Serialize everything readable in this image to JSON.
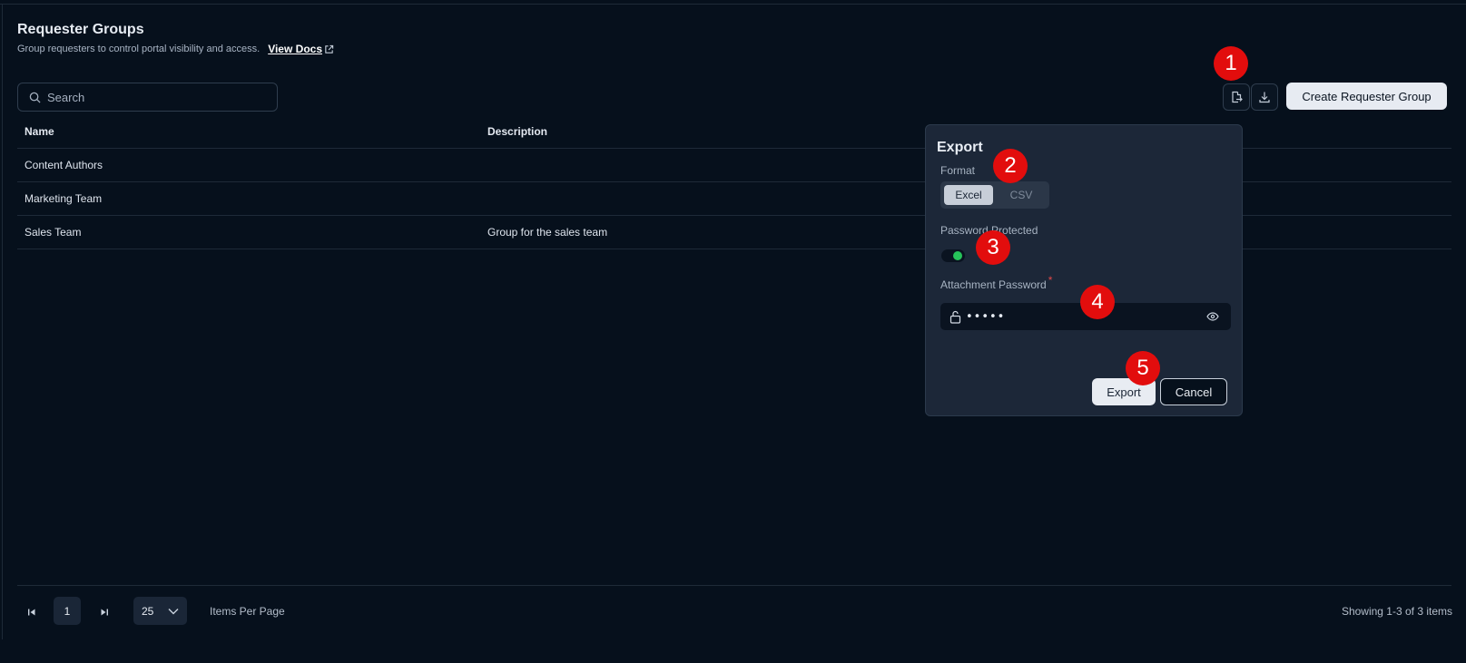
{
  "header": {
    "title": "Requester Groups",
    "subtitle": "Group requesters to control portal visibility and access.",
    "docs_link": "View Docs"
  },
  "toolbar": {
    "search_placeholder": "Search",
    "export_icon": "export-file-icon",
    "download_icon": "download-icon",
    "create_button": "Create Requester Group"
  },
  "table": {
    "columns": [
      "Name",
      "Description"
    ],
    "rows": [
      {
        "name": "Content Authors",
        "description": ""
      },
      {
        "name": "Marketing Team",
        "description": ""
      },
      {
        "name": "Sales Team",
        "description": "Group for the sales team"
      }
    ]
  },
  "pagination": {
    "current_page": "1",
    "per_page": "25",
    "per_page_label": "Items Per Page",
    "showing": "Showing 1-3 of 3 items"
  },
  "export_popover": {
    "title": "Export",
    "format_label": "Format",
    "formats": [
      "Excel",
      "CSV"
    ],
    "selected_format": "Excel",
    "password_protected_label": "Password Protected",
    "password_protected": true,
    "password_label": "Attachment Password",
    "password_value": "•••••",
    "export_button": "Export",
    "cancel_button": "Cancel"
  },
  "annotations": [
    "1",
    "2",
    "3",
    "4",
    "5"
  ],
  "colors": {
    "background": "#06101c",
    "popover": "#1c2738",
    "marker": "#e20d0d",
    "toggle_on": "#26c35a"
  }
}
